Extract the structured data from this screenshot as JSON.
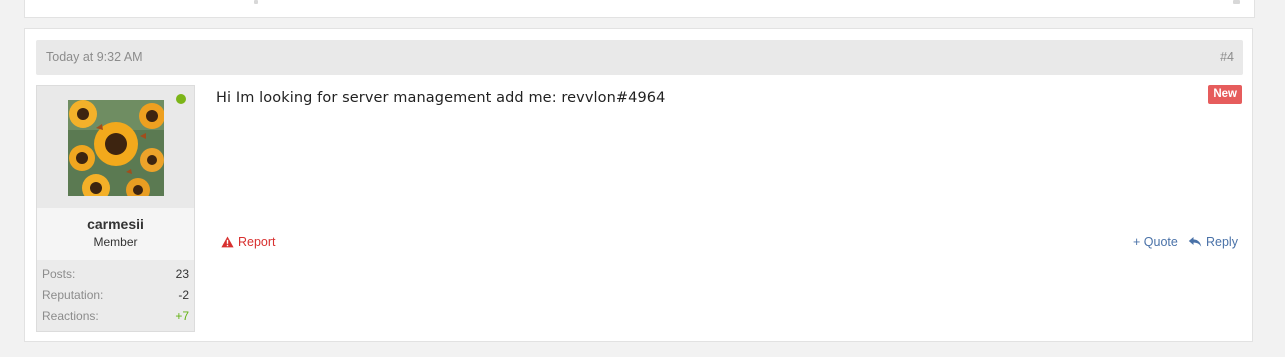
{
  "post": {
    "date": "Today at 9:32 AM",
    "number": "#4",
    "badge": "New",
    "message": "Hi Im looking for server management add me: revvlon#4964",
    "actions": {
      "report": "Report",
      "quote": "+ Quote",
      "reply": "Reply"
    }
  },
  "user": {
    "username": "carmesii",
    "title": "Member",
    "online": true,
    "avatar_icon": "sunflower-avatar",
    "stats": [
      {
        "label": "Posts:",
        "value": "23"
      },
      {
        "label": "Reputation:",
        "value": "-2"
      },
      {
        "label": "Reactions:",
        "value": "+7"
      }
    ]
  },
  "colors": {
    "badge": "#e65c5c",
    "report": "#d8302f",
    "link": "#4a72a8",
    "online": "#7cb518",
    "positive": "#63b212"
  },
  "icons": {
    "report": "warning-triangle-icon",
    "reply": "reply-arrow-icon"
  }
}
